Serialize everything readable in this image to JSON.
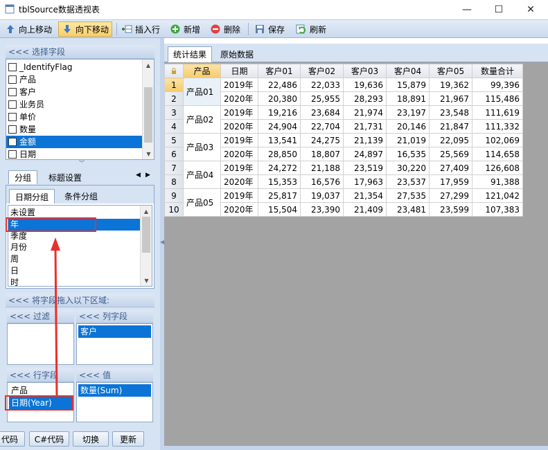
{
  "window": {
    "title": "tblSource数据透视表",
    "minimize": "—",
    "maximize": "☐",
    "close": "✕"
  },
  "toolbar": {
    "move_up": "向上移动",
    "move_down": "向下移动",
    "insert_row": "插入行",
    "add": "新增",
    "delete": "删除",
    "save": "保存",
    "refresh": "刷新"
  },
  "field_chooser": {
    "header": "<<< 选择字段",
    "fields": [
      "_IdentifyFlag",
      "产品",
      "客户",
      "业务员",
      "单价",
      "数量",
      "金额",
      "日期"
    ],
    "selected": "金额"
  },
  "grouping": {
    "tabs": [
      "分组",
      "标题设置"
    ],
    "subtabs": [
      "日期分组",
      "条件分组"
    ],
    "options": [
      "未设置",
      "年",
      "季度",
      "月份",
      "周",
      "日",
      "时"
    ],
    "selected": "年"
  },
  "zones": {
    "header": "<<< 将字段拖入以下区域:",
    "filter": {
      "title": "<<< 过滤",
      "items": []
    },
    "columns": {
      "title": "<<< 列字段",
      "items": [
        "客户"
      ]
    },
    "rows": {
      "title": "<<< 行字段",
      "items": [
        "产品",
        "日期(Year)"
      ]
    },
    "values": {
      "title": "<<< 值",
      "items": [
        "数量(Sum)"
      ]
    }
  },
  "bottom_buttons": [
    "代码",
    "C#代码",
    "切换",
    "更新"
  ],
  "result_tabs": [
    "统计结果",
    "原始数据"
  ],
  "grid": {
    "headers": [
      "产品",
      "日期",
      "客户01",
      "客户02",
      "客户03",
      "客户04",
      "客户05",
      "数量合计"
    ],
    "rows": [
      {
        "n": "1",
        "product": "产品01",
        "year": "2019年",
        "v": [
          "22,486",
          "22,033",
          "19,636",
          "15,879",
          "19,362",
          "99,396"
        ]
      },
      {
        "n": "2",
        "product": "",
        "year": "2020年",
        "v": [
          "20,380",
          "25,955",
          "28,293",
          "18,891",
          "21,967",
          "115,486"
        ]
      },
      {
        "n": "3",
        "product": "产品02",
        "year": "2019年",
        "v": [
          "19,216",
          "23,684",
          "21,974",
          "23,197",
          "23,548",
          "111,619"
        ]
      },
      {
        "n": "4",
        "product": "",
        "year": "2020年",
        "v": [
          "24,904",
          "22,704",
          "21,731",
          "20,146",
          "21,847",
          "111,332"
        ]
      },
      {
        "n": "5",
        "product": "产品03",
        "year": "2019年",
        "v": [
          "13,541",
          "24,275",
          "21,139",
          "21,019",
          "22,095",
          "102,069"
        ]
      },
      {
        "n": "6",
        "product": "",
        "year": "2020年",
        "v": [
          "28,850",
          "18,807",
          "24,897",
          "16,535",
          "25,569",
          "114,658"
        ]
      },
      {
        "n": "7",
        "product": "产品04",
        "year": "2019年",
        "v": [
          "24,272",
          "21,188",
          "23,519",
          "30,220",
          "27,409",
          "126,608"
        ]
      },
      {
        "n": "8",
        "product": "",
        "year": "2020年",
        "v": [
          "15,353",
          "16,576",
          "17,963",
          "23,537",
          "17,959",
          "91,388"
        ]
      },
      {
        "n": "9",
        "product": "产品05",
        "year": "2019年",
        "v": [
          "25,817",
          "19,037",
          "21,354",
          "27,535",
          "27,299",
          "121,042"
        ]
      },
      {
        "n": "10",
        "product": "",
        "year": "2020年",
        "v": [
          "15,504",
          "23,390",
          "21,409",
          "23,481",
          "23,599",
          "107,383"
        ]
      }
    ]
  },
  "colors": {
    "selection": "#0b74d6",
    "annotation": "#e8302a",
    "panel": "#d6e3f3",
    "grid_bg": "#a3a3a3"
  }
}
